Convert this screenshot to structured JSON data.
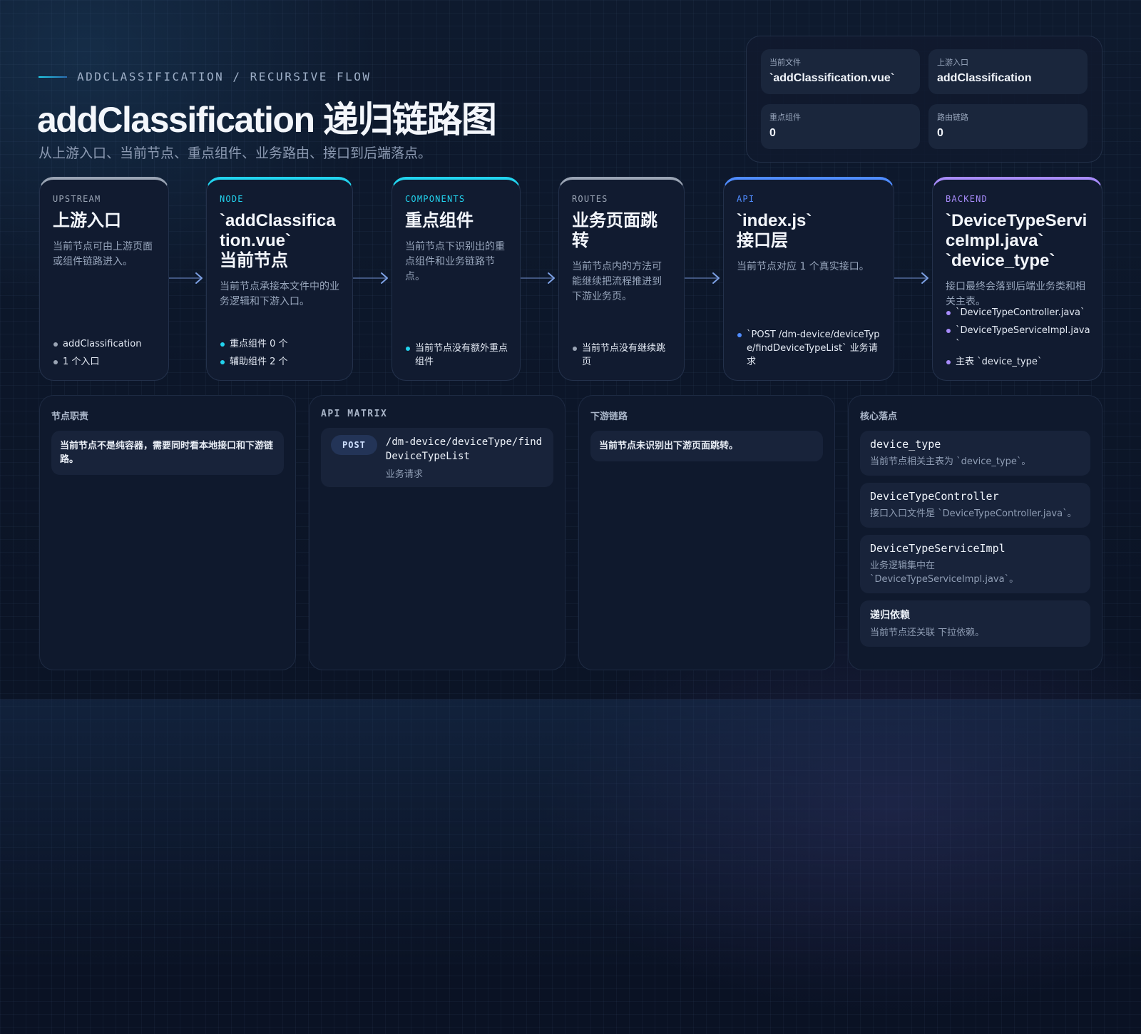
{
  "header": {
    "eyebrow": "ADDCLASSIFICATION / RECURSIVE FLOW",
    "title": "addClassification 递归链路图",
    "subtitle": "从上游入口、当前节点、重点组件、业务路由、接口到后端落点。"
  },
  "stats": [
    {
      "label": "当前文件",
      "value": "`addClassification.vue`"
    },
    {
      "label": "上游入口",
      "value": "addClassification"
    },
    {
      "label": "重点组件",
      "value": "0"
    },
    {
      "label": "路由链路",
      "value": "0"
    }
  ],
  "colors": {
    "upstream": "#9aa4b4",
    "node": "#22d3ee",
    "components": "#22d3ee",
    "routes": "#9aa4b4",
    "api": "#4f8cff",
    "backend": "#a78bfa",
    "arrow": "#7ea2e6"
  },
  "flow": [
    {
      "kicker": "UPSTREAM",
      "title": "上游入口",
      "desc": "当前节点可由上游页面或组件链路进入。",
      "bullets": [
        "addClassification",
        "1 个入口"
      ]
    },
    {
      "kicker": "NODE",
      "title_lines": [
        "`addClassification.vue`",
        "当前节点"
      ],
      "desc": "当前节点承接本文件中的业务逻辑和下游入口。",
      "bullets": [
        "重点组件 0 个",
        "辅助组件 2 个"
      ]
    },
    {
      "kicker": "COMPONENTS",
      "title": "重点组件",
      "desc": "当前节点下识别出的重点组件和业务链路节点。",
      "bullets": [
        "当前节点没有额外重点组件"
      ]
    },
    {
      "kicker": "ROUTES",
      "title": "业务页面跳转",
      "desc": "当前节点内的方法可能继续把流程推进到下游业务页。",
      "bullets": [
        "当前节点没有继续跳页"
      ]
    },
    {
      "kicker": "API",
      "title_lines": [
        "`index.js`",
        "接口层"
      ],
      "desc": "当前节点对应 1 个真实接口。",
      "bullets": [
        "`POST /dm-device/deviceType/findDeviceTypeList` 业务请求"
      ]
    },
    {
      "kicker": "BACKEND",
      "title_lines": [
        "`DeviceTypeServiceImpl.java`",
        "`device_type`"
      ],
      "desc": "接口最终会落到后端业务类和相关主表。",
      "bullets": [
        "`DeviceTypeController.java`",
        "`DeviceTypeServiceImpl.java`",
        "主表 `device_type`"
      ]
    }
  ],
  "panels": {
    "duty": {
      "title": "节点职责",
      "text": "当前节点不是纯容器，需要同时看本地接口和下游链路。"
    },
    "api": {
      "title": "API MATRIX",
      "rows": [
        {
          "method": "POST",
          "path": "/dm-device/deviceType/findDeviceTypeList",
          "desc": "业务请求"
        }
      ]
    },
    "downstream": {
      "title": "下游链路",
      "text": "当前节点未识别出下游页面跳转。"
    },
    "core": {
      "title": "核心落点",
      "items": [
        {
          "name": "device_type",
          "desc": "当前节点相关主表为 `device_type`。"
        },
        {
          "name": "DeviceTypeController",
          "desc": "接口入口文件是 `DeviceTypeController.java`。"
        },
        {
          "name": "DeviceTypeServiceImpl",
          "desc": "业务逻辑集中在 `DeviceTypeServiceImpl.java`。"
        },
        {
          "name": "递归依赖",
          "desc": "当前节点还关联 下拉依赖。"
        }
      ]
    }
  }
}
